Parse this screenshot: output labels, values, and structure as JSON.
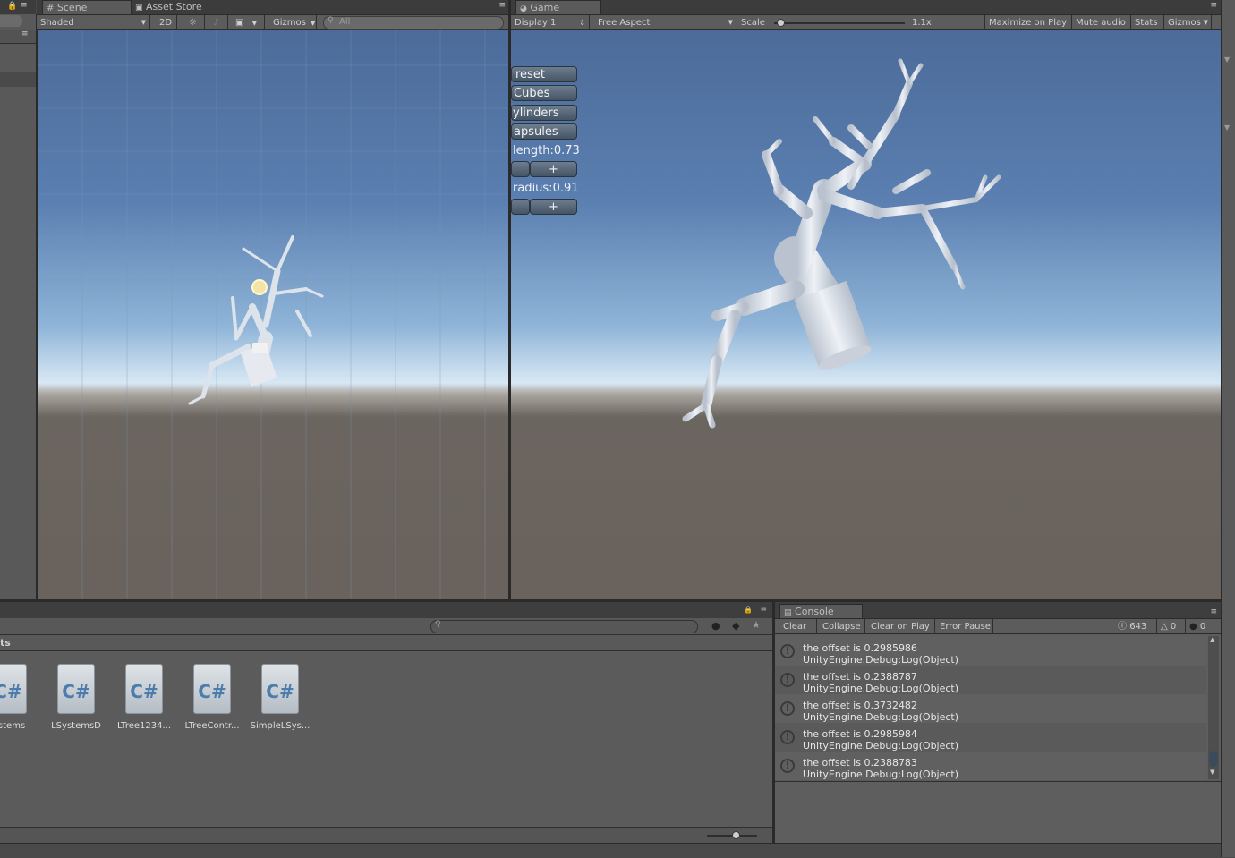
{
  "scene": {
    "tab_label": "Scene",
    "tab2_label": "Asset Store",
    "shading": "Shaded",
    "mode_2d": "2D",
    "gizmos": "Gizmos",
    "search_placeholder": "All"
  },
  "game": {
    "tab_label": "Game",
    "display": "Display 1",
    "aspect": "Free Aspect",
    "scale_label": "Scale",
    "scale_value": "1.1x",
    "scale_fraction": 0.02,
    "maximize": "Maximize on Play",
    "mute": "Mute audio",
    "stats": "Stats",
    "gizmos": "Gizmos",
    "gui": {
      "reset": "reset",
      "cubes": "Cubes",
      "cylinders": "ylinders",
      "capsules": "apsules",
      "length_label": "length:0.73",
      "plus1": "+",
      "radius_label": "radius:0.91",
      "plus2": "+"
    }
  },
  "project": {
    "breadcrumb": "ts",
    "assets": [
      {
        "icon": "C#",
        "name": "ystems"
      },
      {
        "icon": "C#",
        "name": "LSystemsD"
      },
      {
        "icon": "C#",
        "name": "LTree1234..."
      },
      {
        "icon": "C#",
        "name": "LTreeContr..."
      },
      {
        "icon": "C#",
        "name": "SimpleLSys..."
      }
    ]
  },
  "console": {
    "tab_label": "Console",
    "clear": "Clear",
    "collapse": "Collapse",
    "clear_on_play": "Clear on Play",
    "error_pause": "Error Pause",
    "log_count": "643",
    "warn_count": "0",
    "error_count": "0",
    "rows": [
      {
        "line1": "the offset is 0.2985986",
        "line2": "UnityEngine.Debug:Log(Object)"
      },
      {
        "line1": "the offset is 0.2388787",
        "line2": "UnityEngine.Debug:Log(Object)"
      },
      {
        "line1": "the offset is 0.3732482",
        "line2": "UnityEngine.Debug:Log(Object)"
      },
      {
        "line1": "the offset is 0.2985984",
        "line2": "UnityEngine.Debug:Log(Object)"
      },
      {
        "line1": "the offset is 0.2388783",
        "line2": "UnityEngine.Debug:Log(Object)"
      }
    ]
  },
  "colors": {
    "editor_bg": "#494949",
    "gui_button": "#5a6a7c",
    "tree": "#e4e8ef"
  }
}
